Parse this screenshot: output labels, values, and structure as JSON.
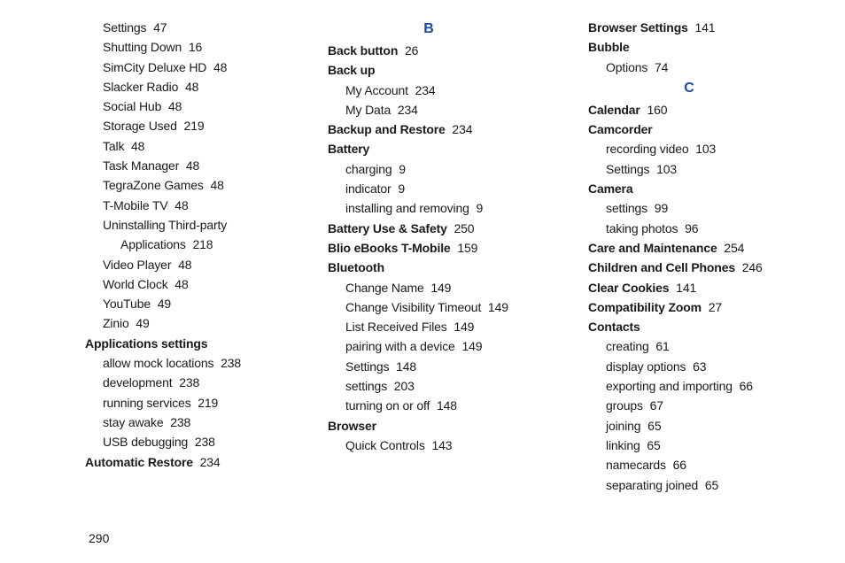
{
  "pageNumber": "290",
  "columns": [
    {
      "entries": [
        {
          "type": "line",
          "bold": false,
          "indent": 0,
          "label": "Settings",
          "page": "47"
        },
        {
          "type": "line",
          "bold": false,
          "indent": 0,
          "label": "Shutting Down",
          "page": "16"
        },
        {
          "type": "line",
          "bold": false,
          "indent": 0,
          "label": "SimCity Deluxe HD",
          "page": "48"
        },
        {
          "type": "line",
          "bold": false,
          "indent": 0,
          "label": "Slacker Radio",
          "page": "48"
        },
        {
          "type": "line",
          "bold": false,
          "indent": 0,
          "label": "Social Hub",
          "page": "48"
        },
        {
          "type": "line",
          "bold": false,
          "indent": 0,
          "label": "Storage Used",
          "page": "219"
        },
        {
          "type": "line",
          "bold": false,
          "indent": 0,
          "label": "Talk",
          "page": "48"
        },
        {
          "type": "line",
          "bold": false,
          "indent": 0,
          "label": "Task Manager",
          "page": "48"
        },
        {
          "type": "line",
          "bold": false,
          "indent": 0,
          "label": "TegraZone Games",
          "page": "48"
        },
        {
          "type": "line",
          "bold": false,
          "indent": 0,
          "label": "T-Mobile TV",
          "page": "48"
        },
        {
          "type": "line",
          "bold": false,
          "indent": 0,
          "label": "Uninstalling Third-party",
          "page": ""
        },
        {
          "type": "line",
          "bold": false,
          "indent": 1,
          "label": "Applications",
          "page": "218"
        },
        {
          "type": "line",
          "bold": false,
          "indent": 0,
          "label": "Video Player",
          "page": "48"
        },
        {
          "type": "line",
          "bold": false,
          "indent": 0,
          "label": "World Clock",
          "page": "48"
        },
        {
          "type": "line",
          "bold": false,
          "indent": 0,
          "label": "YouTube",
          "page": "49"
        },
        {
          "type": "line",
          "bold": false,
          "indent": 0,
          "label": "Zinio",
          "page": "49"
        },
        {
          "type": "line",
          "bold": true,
          "indent": -1,
          "label": "Applications settings",
          "page": ""
        },
        {
          "type": "line",
          "bold": false,
          "indent": 0,
          "label": "allow mock locations",
          "page": "238"
        },
        {
          "type": "line",
          "bold": false,
          "indent": 0,
          "label": "development",
          "page": "238"
        },
        {
          "type": "line",
          "bold": false,
          "indent": 0,
          "label": "running services",
          "page": "219"
        },
        {
          "type": "line",
          "bold": false,
          "indent": 0,
          "label": "stay awake",
          "page": "238"
        },
        {
          "type": "line",
          "bold": false,
          "indent": 0,
          "label": "USB debugging",
          "page": "238"
        },
        {
          "type": "line",
          "bold": true,
          "indent": -1,
          "label": "Automatic Restore",
          "page": "234"
        }
      ]
    },
    {
      "entries": [
        {
          "type": "header",
          "label": "B"
        },
        {
          "type": "line",
          "bold": true,
          "indent": -1,
          "label": "Back button",
          "page": "26"
        },
        {
          "type": "line",
          "bold": true,
          "indent": -1,
          "label": "Back up",
          "page": ""
        },
        {
          "type": "line",
          "bold": false,
          "indent": 0,
          "label": "My Account",
          "page": "234"
        },
        {
          "type": "line",
          "bold": false,
          "indent": 0,
          "label": "My Data",
          "page": "234"
        },
        {
          "type": "line",
          "bold": true,
          "indent": -1,
          "label": "Backup and Restore",
          "page": "234"
        },
        {
          "type": "line",
          "bold": true,
          "indent": -1,
          "label": "Battery",
          "page": ""
        },
        {
          "type": "line",
          "bold": false,
          "indent": 0,
          "label": "charging",
          "page": "9"
        },
        {
          "type": "line",
          "bold": false,
          "indent": 0,
          "label": "indicator",
          "page": "9"
        },
        {
          "type": "line",
          "bold": false,
          "indent": 0,
          "label": "installing and removing",
          "page": "9"
        },
        {
          "type": "line",
          "bold": true,
          "indent": -1,
          "label": "Battery Use & Safety",
          "page": "250"
        },
        {
          "type": "line",
          "bold": true,
          "indent": -1,
          "label": "Blio eBooks T-Mobile",
          "page": "159"
        },
        {
          "type": "line",
          "bold": true,
          "indent": -1,
          "label": "Bluetooth",
          "page": ""
        },
        {
          "type": "line",
          "bold": false,
          "indent": 0,
          "label": "Change Name",
          "page": "149"
        },
        {
          "type": "line",
          "bold": false,
          "indent": 0,
          "label": "Change Visibility Timeout",
          "page": "149"
        },
        {
          "type": "line",
          "bold": false,
          "indent": 0,
          "label": "List Received Files",
          "page": "149"
        },
        {
          "type": "line",
          "bold": false,
          "indent": 0,
          "label": "pairing with a device",
          "page": "149"
        },
        {
          "type": "line",
          "bold": false,
          "indent": 0,
          "label": "Settings",
          "page": "148"
        },
        {
          "type": "line",
          "bold": false,
          "indent": 0,
          "label": "settings",
          "page": "203"
        },
        {
          "type": "line",
          "bold": false,
          "indent": 0,
          "label": "turning on or off",
          "page": "148"
        },
        {
          "type": "line",
          "bold": true,
          "indent": -1,
          "label": "Browser",
          "page": ""
        },
        {
          "type": "line",
          "bold": false,
          "indent": 0,
          "label": "Quick Controls",
          "page": "143"
        }
      ]
    },
    {
      "entries": [
        {
          "type": "line",
          "bold": true,
          "indent": -1,
          "label": "Browser Settings",
          "page": "141"
        },
        {
          "type": "line",
          "bold": true,
          "indent": -1,
          "label": "Bubble",
          "page": ""
        },
        {
          "type": "line",
          "bold": false,
          "indent": 0,
          "label": "Options",
          "page": "74"
        },
        {
          "type": "header",
          "label": "C"
        },
        {
          "type": "line",
          "bold": true,
          "indent": -1,
          "label": "Calendar",
          "page": "160"
        },
        {
          "type": "line",
          "bold": true,
          "indent": -1,
          "label": "Camcorder",
          "page": ""
        },
        {
          "type": "line",
          "bold": false,
          "indent": 0,
          "label": "recording video",
          "page": "103"
        },
        {
          "type": "line",
          "bold": false,
          "indent": 0,
          "label": "Settings",
          "page": "103"
        },
        {
          "type": "line",
          "bold": true,
          "indent": -1,
          "label": "Camera",
          "page": ""
        },
        {
          "type": "line",
          "bold": false,
          "indent": 0,
          "label": "settings",
          "page": "99"
        },
        {
          "type": "line",
          "bold": false,
          "indent": 0,
          "label": "taking photos",
          "page": "96"
        },
        {
          "type": "line",
          "bold": true,
          "indent": -1,
          "label": "Care and Maintenance",
          "page": "254"
        },
        {
          "type": "line",
          "bold": true,
          "indent": -1,
          "label": "Children and Cell Phones",
          "page": "246"
        },
        {
          "type": "line",
          "bold": true,
          "indent": -1,
          "label": "Clear Cookies",
          "page": "141"
        },
        {
          "type": "line",
          "bold": true,
          "indent": -1,
          "label": "Compatibility Zoom",
          "page": "27"
        },
        {
          "type": "line",
          "bold": true,
          "indent": -1,
          "label": "Contacts",
          "page": ""
        },
        {
          "type": "line",
          "bold": false,
          "indent": 0,
          "label": "creating",
          "page": "61"
        },
        {
          "type": "line",
          "bold": false,
          "indent": 0,
          "label": "display options",
          "page": "63"
        },
        {
          "type": "line",
          "bold": false,
          "indent": 0,
          "label": "exporting and importing",
          "page": "66"
        },
        {
          "type": "line",
          "bold": false,
          "indent": 0,
          "label": "groups",
          "page": "67"
        },
        {
          "type": "line",
          "bold": false,
          "indent": 0,
          "label": "joining",
          "page": "65"
        },
        {
          "type": "line",
          "bold": false,
          "indent": 0,
          "label": "linking",
          "page": "65"
        },
        {
          "type": "line",
          "bold": false,
          "indent": 0,
          "label": "namecards",
          "page": "66"
        },
        {
          "type": "line",
          "bold": false,
          "indent": 0,
          "label": "separating joined",
          "page": "65"
        }
      ]
    }
  ]
}
